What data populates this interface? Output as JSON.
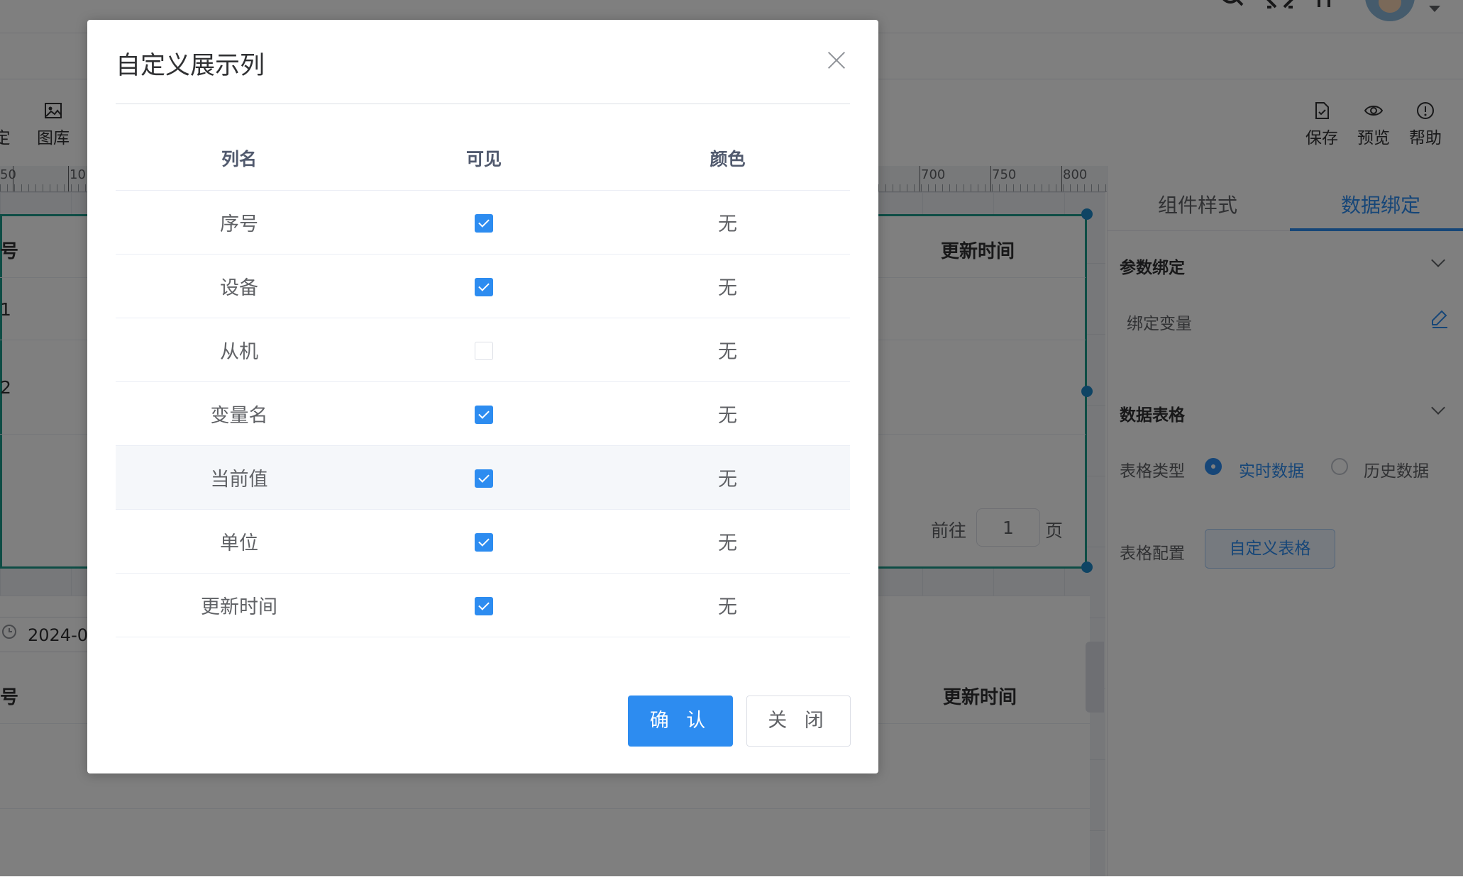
{
  "toolbar": {
    "partial_left_label": "定",
    "gallery_label": "图库",
    "save_label": "保存",
    "preview_label": "预览",
    "help_label": "帮助"
  },
  "ruler": {
    "left_ticks": [
      "50",
      "10"
    ],
    "right_ticks": [
      "700",
      "750",
      "800"
    ]
  },
  "canvas": {
    "table1": {
      "col_partial": "号",
      "col_update_time": "更新时间",
      "row_partial_1": "1",
      "row_partial_2": "2"
    },
    "pager": {
      "goto_label": "前往",
      "page_value": "1",
      "page_suffix": "页"
    },
    "table2": {
      "date_value": "2024-0",
      "col_partial": "号",
      "col_update_time": "更新时间"
    }
  },
  "right_panel": {
    "tabs": [
      {
        "label": "组件样式",
        "active": false
      },
      {
        "label": "数据绑定",
        "active": true
      }
    ],
    "param_section_title": "参数绑定",
    "bind_variable_label": "绑定变量",
    "data_table_section_title": "数据表格",
    "table_type_label": "表格类型",
    "table_type_options": [
      {
        "label": "实时数据",
        "selected": true
      },
      {
        "label": "历史数据",
        "selected": false
      }
    ],
    "table_config_label": "表格配置",
    "custom_table_button": "自定义表格"
  },
  "dialog": {
    "title": "自定义展示列",
    "headers": {
      "name": "列名",
      "visible": "可见",
      "color": "颜色"
    },
    "rows": [
      {
        "name": "序号",
        "visible": true,
        "color": "无"
      },
      {
        "name": "设备",
        "visible": true,
        "color": "无"
      },
      {
        "name": "从机",
        "visible": false,
        "color": "无"
      },
      {
        "name": "变量名",
        "visible": true,
        "color": "无"
      },
      {
        "name": "当前值",
        "visible": true,
        "color": "无"
      },
      {
        "name": "单位",
        "visible": true,
        "color": "无"
      },
      {
        "name": "更新时间",
        "visible": true,
        "color": "无"
      }
    ],
    "confirm_label": "确 认",
    "close_label": "关 闭"
  },
  "colors": {
    "primary": "#2d8cf0",
    "component_border": "#1c9a8a",
    "overlay": "rgba(0,0,0,0.5)"
  }
}
